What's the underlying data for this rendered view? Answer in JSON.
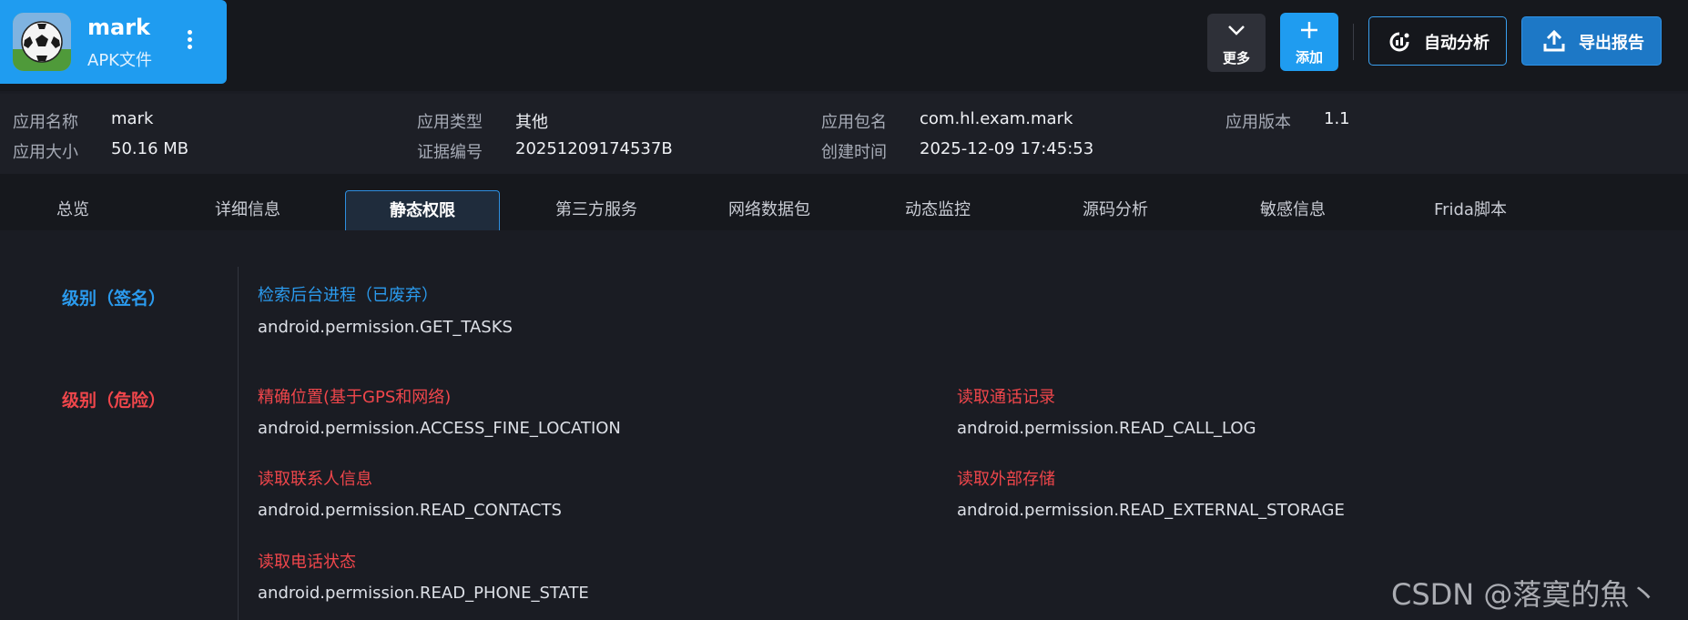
{
  "app": {
    "name": "mark",
    "subtitle": "APK文件"
  },
  "toolbar": {
    "more_label": "更多",
    "add_label": "添加",
    "auto_analyze_label": "自动分析",
    "export_report_label": "导出报告"
  },
  "info": {
    "app_name_label": "应用名称",
    "app_name": "mark",
    "app_type_label": "应用类型",
    "app_type": "其他",
    "package_label": "应用包名",
    "package": "com.hl.exam.mark",
    "version_label": "应用版本",
    "version": "1.1",
    "size_label": "应用大小",
    "size": "50.16 MB",
    "cert_label": "证据编号",
    "cert": "20251209174537B",
    "created_label": "创建时间",
    "created": "2025-12-09 17:45:53"
  },
  "tabs": [
    {
      "label": "总览"
    },
    {
      "label": "详细信息"
    },
    {
      "label": "静态权限",
      "active": true
    },
    {
      "label": "第三方服务"
    },
    {
      "label": "网络数据包"
    },
    {
      "label": "动态监控"
    },
    {
      "label": "源码分析"
    },
    {
      "label": "敏感信息"
    },
    {
      "label": "Frida脚本"
    }
  ],
  "permissions": {
    "signature": {
      "level": "级别（签名）",
      "items": [
        {
          "title": "检索后台进程（已废弃）",
          "value": "android.permission.GET_TASKS"
        }
      ]
    },
    "dangerous": {
      "level": "级别（危险）",
      "items": [
        {
          "title": "精确位置(基于GPS和网络)",
          "value": "android.permission.ACCESS_FINE_LOCATION"
        },
        {
          "title": "读取通话记录",
          "value": "android.permission.READ_CALL_LOG"
        },
        {
          "title": "读取联系人信息",
          "value": "android.permission.READ_CONTACTS"
        },
        {
          "title": "读取外部存储",
          "value": "android.permission.READ_EXTERNAL_STORAGE"
        },
        {
          "title": "读取电话状态",
          "value": "android.permission.READ_PHONE_STATE"
        }
      ]
    }
  },
  "watermark": "CSDN @落寞的魚丶",
  "colors": {
    "accent": "#1f9cf0",
    "danger": "#f0464b",
    "signature": "#2b9bee",
    "background": "#1a1c23"
  }
}
